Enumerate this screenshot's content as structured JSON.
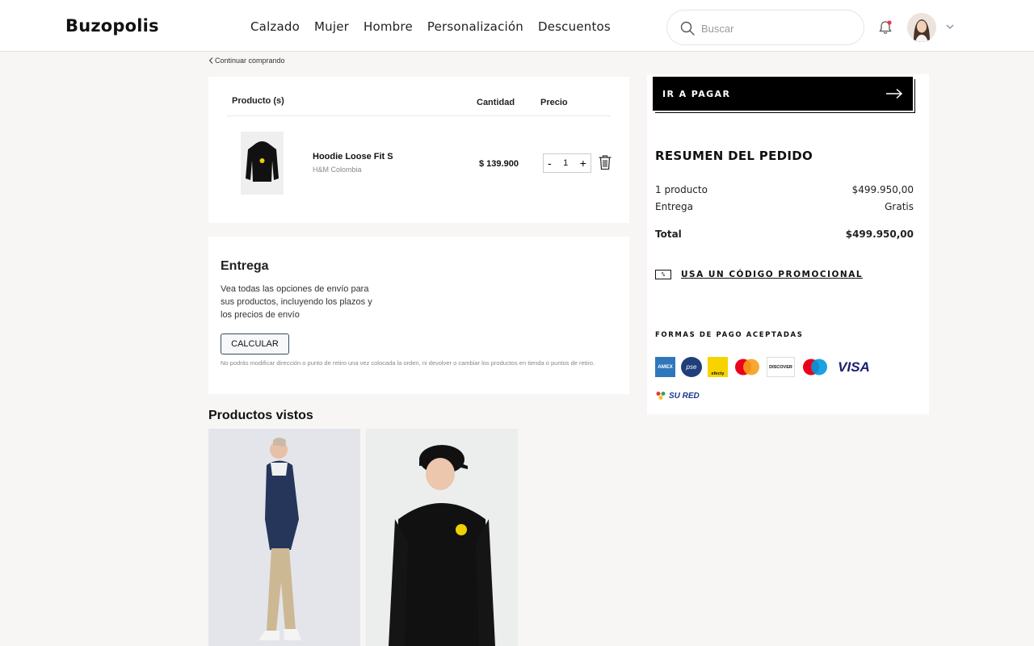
{
  "header": {
    "logo": "Buzopolis",
    "nav": [
      "Calzado",
      "Mujer",
      "Hombre",
      "Personalización",
      "Descuentos"
    ],
    "search_placeholder": "Buscar"
  },
  "back_link": "Continuar comprando",
  "cart": {
    "col_product": "Producto (s)",
    "col_quantity": "Cantidad",
    "col_price": "Precio",
    "item": {
      "name": "Hoodie Loose Fit S",
      "brand": "H&M Colombia",
      "price": "$ 139.900",
      "quantity": "1",
      "minus": "-",
      "plus": "+"
    }
  },
  "delivery": {
    "title": "Entrega",
    "text": "Vea todas las opciones de envío para sus productos, incluyendo los plazos y los precios de envío",
    "button": "CALCULAR",
    "note": "No podrás modificar dirección o punto de retiro una vez colocada la orden, ni devolver o cambiar los productos en tienda o puntos de retiro."
  },
  "seen": {
    "title": "Productos vistos"
  },
  "summary": {
    "pay_button": "IR A PAGAR",
    "title": "RESUMEN DEL PEDIDO",
    "products_label": "1 producto",
    "products_value": "$499.950,00",
    "delivery_label": "Entrega",
    "delivery_value": "Gratis",
    "total_label": "Total",
    "total_value": "$499.950,00",
    "promo_icon": "%",
    "promo": "USA UN CÓDIGO PROMOCIONAL",
    "payment_label": "FORMAS DE PAGO ACEPTADAS",
    "payment_logos": [
      "AMEX",
      "pse",
      "efecty",
      "DISCOVER",
      "VISA"
    ],
    "sured": "SU RED"
  },
  "colors": {
    "accent_black": "#000000",
    "background": "#f7f6f4",
    "notification_dot": "#e53950",
    "visa_blue": "#1a1f71"
  }
}
